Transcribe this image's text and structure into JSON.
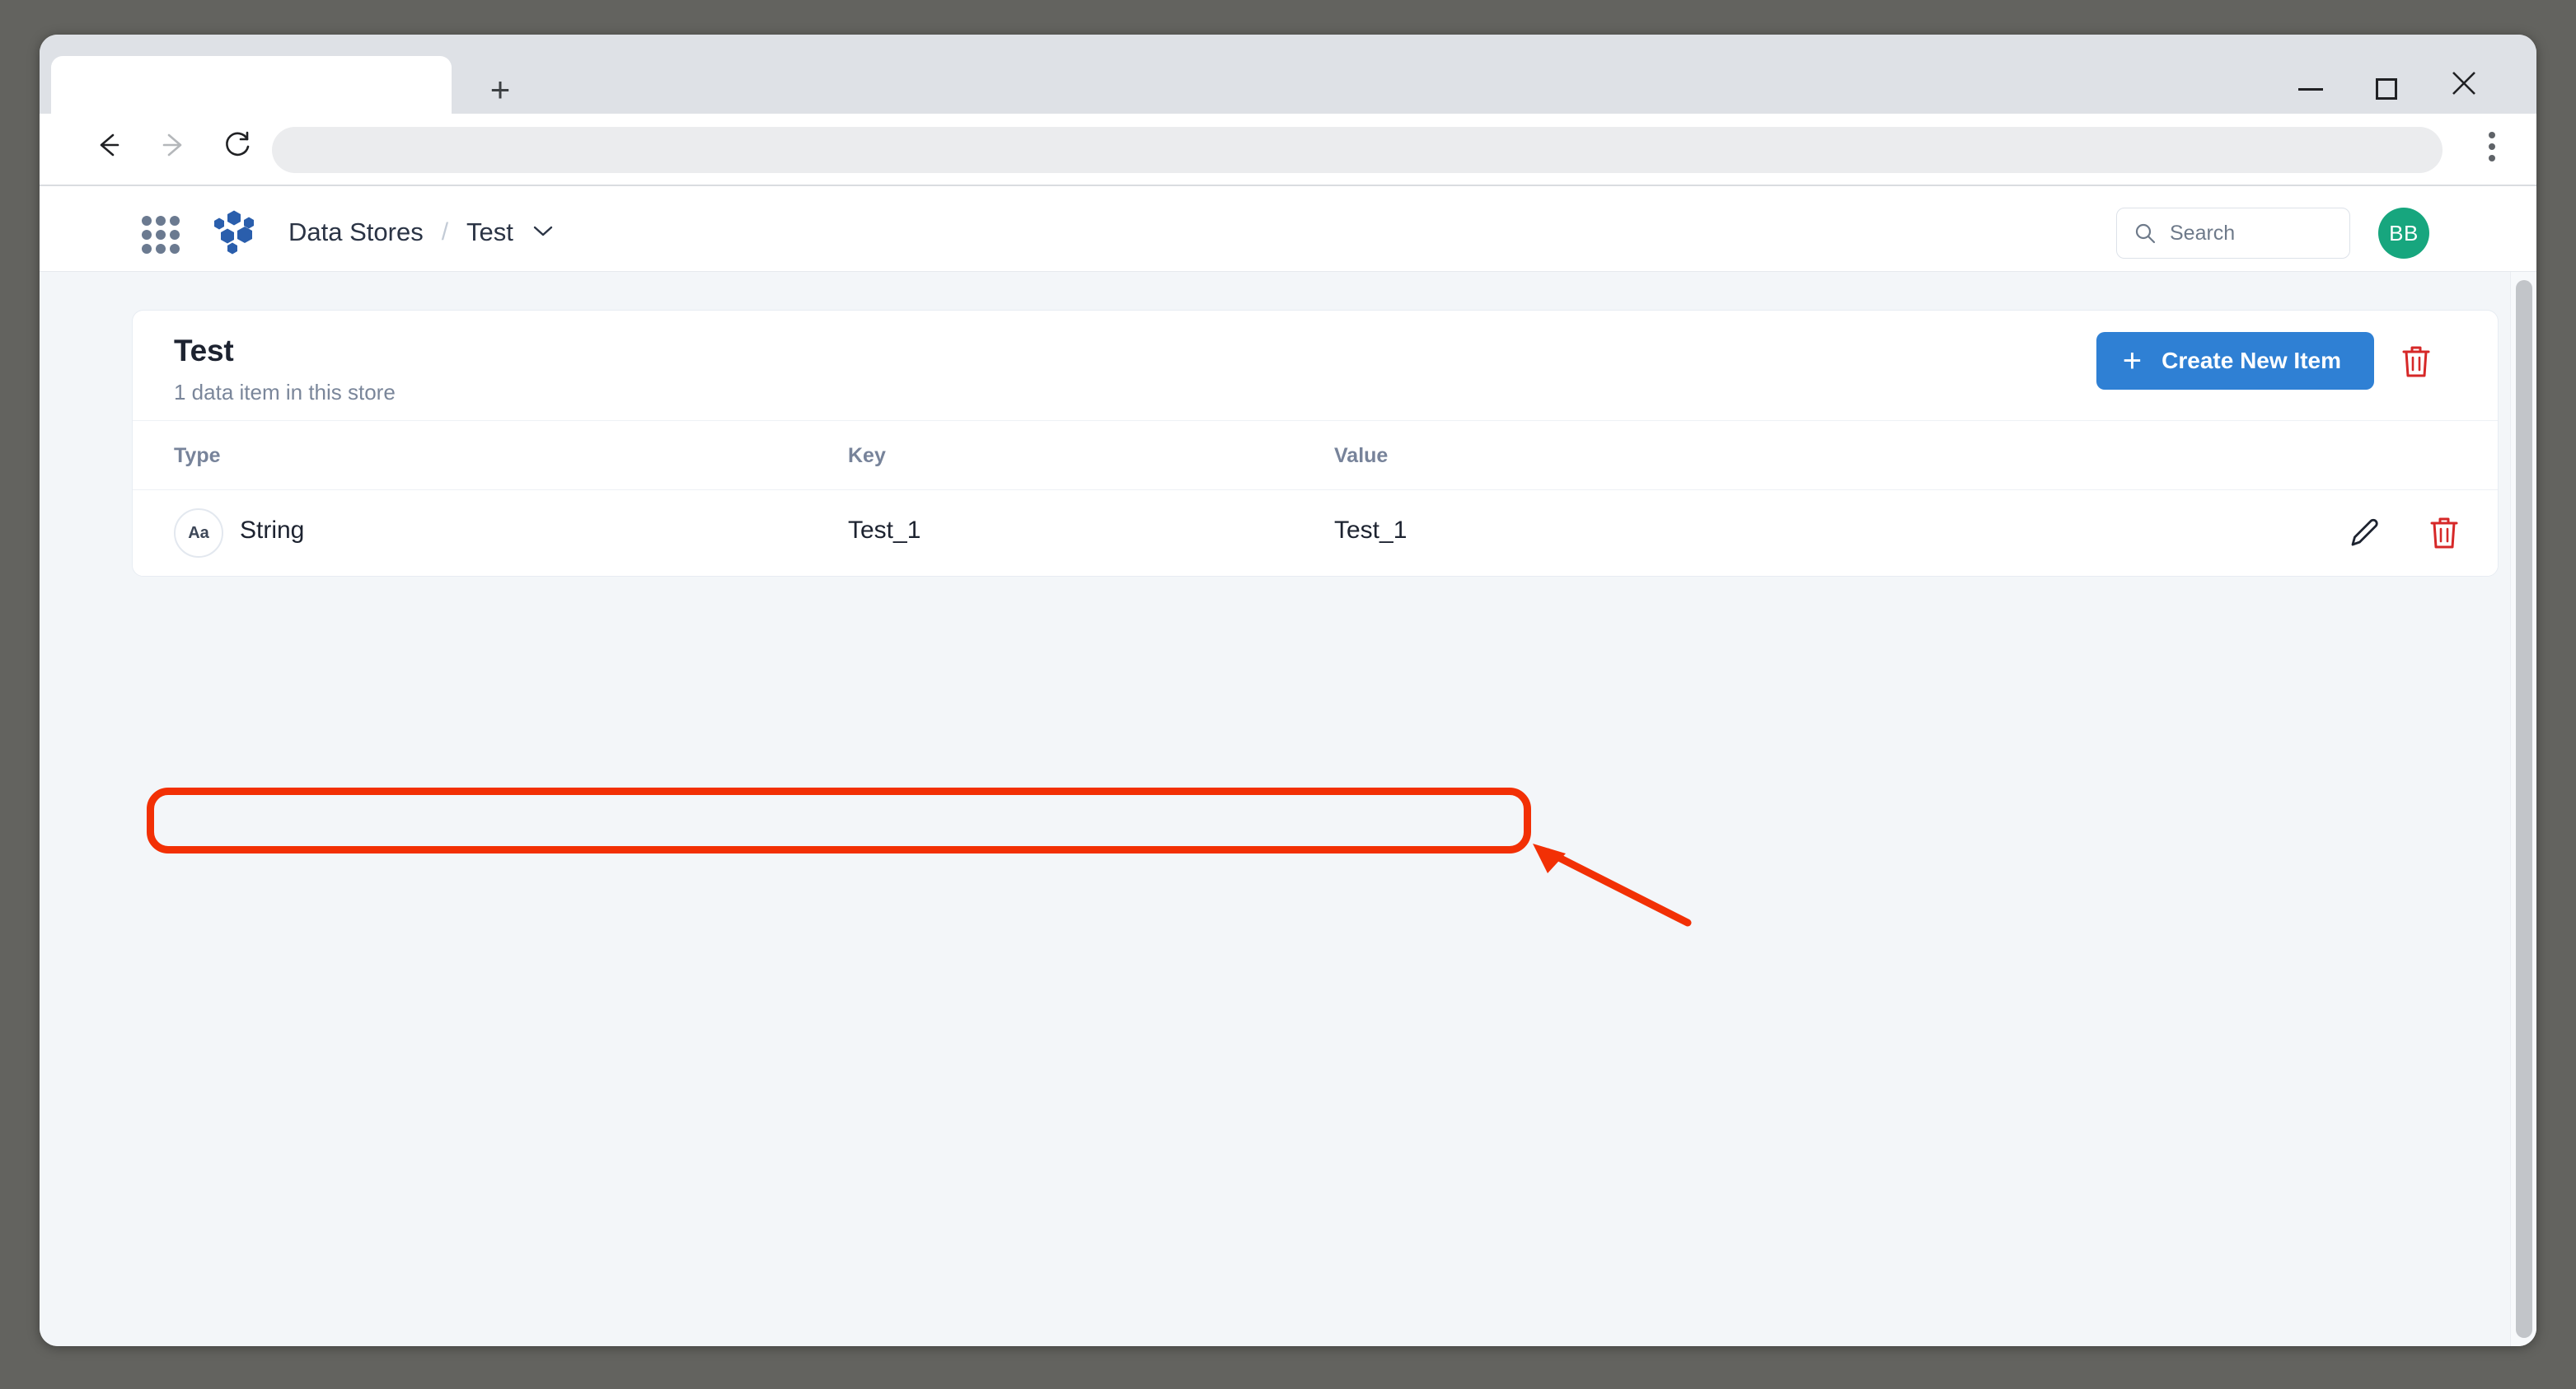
{
  "browser": {
    "tab_title": "",
    "new_tab_label": "+",
    "back_icon": "arrow-left-icon",
    "forward_icon": "arrow-right-icon",
    "reload_icon": "reload-icon",
    "menu_icon": "three-dot-menu-icon",
    "address_value": "",
    "window_controls": {
      "minimize": "—",
      "maximize": "□",
      "close": "✕"
    }
  },
  "app_header": {
    "apps_grid_icon": "apps-grid-icon",
    "logo_icon": "hexagon-cluster-logo",
    "breadcrumb": {
      "root": "Data Stores",
      "separator": "/",
      "current": "Test",
      "caret": "chevron-down-icon"
    },
    "search": {
      "icon": "search-icon",
      "placeholder": "Search",
      "value": ""
    },
    "avatar": {
      "initials": "BB",
      "color": "#17a67e"
    }
  },
  "card": {
    "title": "Test",
    "subtitle": "1 data item in this store",
    "create_button": {
      "label": "Create New Item",
      "icon": "plus-icon",
      "color": "#2f80d4"
    },
    "delete_store_icon": "trash-icon",
    "columns": [
      "Type",
      "Key",
      "Value"
    ],
    "rows": [
      {
        "type_badge": "Aa",
        "type": "String",
        "key": "Test_1",
        "value": "Test_1",
        "edit_icon": "pencil-icon",
        "delete_icon": "trash-icon"
      }
    ]
  },
  "annotation": {
    "color": "#f23005",
    "highlight_target": "data-row",
    "arrow": "arrow-pointing-upper-left"
  }
}
